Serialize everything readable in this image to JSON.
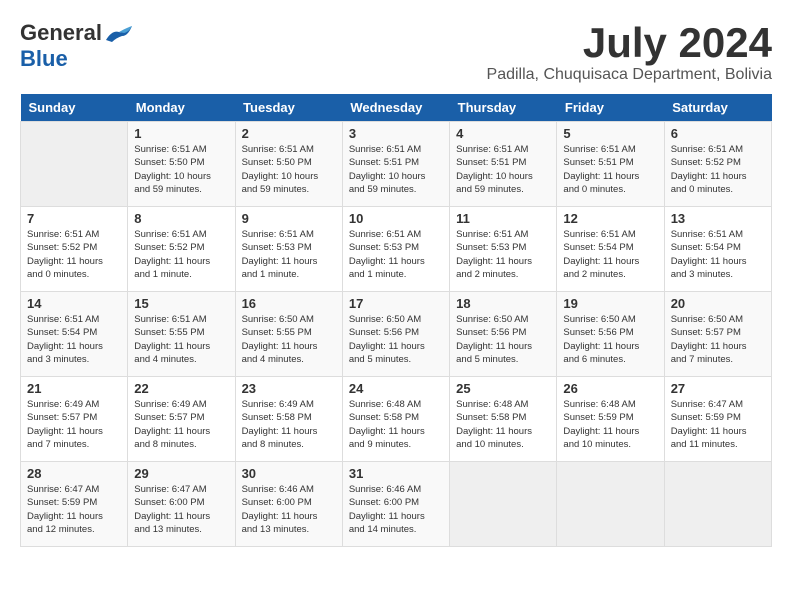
{
  "header": {
    "logo_general": "General",
    "logo_blue": "Blue",
    "month": "July 2024",
    "location": "Padilla, Chuquisaca Department, Bolivia"
  },
  "calendar": {
    "weekdays": [
      "Sunday",
      "Monday",
      "Tuesday",
      "Wednesday",
      "Thursday",
      "Friday",
      "Saturday"
    ],
    "weeks": [
      [
        {
          "day": "",
          "info": ""
        },
        {
          "day": "1",
          "info": "Sunrise: 6:51 AM\nSunset: 5:50 PM\nDaylight: 10 hours\nand 59 minutes."
        },
        {
          "day": "2",
          "info": "Sunrise: 6:51 AM\nSunset: 5:50 PM\nDaylight: 10 hours\nand 59 minutes."
        },
        {
          "day": "3",
          "info": "Sunrise: 6:51 AM\nSunset: 5:51 PM\nDaylight: 10 hours\nand 59 minutes."
        },
        {
          "day": "4",
          "info": "Sunrise: 6:51 AM\nSunset: 5:51 PM\nDaylight: 10 hours\nand 59 minutes."
        },
        {
          "day": "5",
          "info": "Sunrise: 6:51 AM\nSunset: 5:51 PM\nDaylight: 11 hours\nand 0 minutes."
        },
        {
          "day": "6",
          "info": "Sunrise: 6:51 AM\nSunset: 5:52 PM\nDaylight: 11 hours\nand 0 minutes."
        }
      ],
      [
        {
          "day": "7",
          "info": "Sunrise: 6:51 AM\nSunset: 5:52 PM\nDaylight: 11 hours\nand 0 minutes."
        },
        {
          "day": "8",
          "info": "Sunrise: 6:51 AM\nSunset: 5:52 PM\nDaylight: 11 hours\nand 1 minute."
        },
        {
          "day": "9",
          "info": "Sunrise: 6:51 AM\nSunset: 5:53 PM\nDaylight: 11 hours\nand 1 minute."
        },
        {
          "day": "10",
          "info": "Sunrise: 6:51 AM\nSunset: 5:53 PM\nDaylight: 11 hours\nand 1 minute."
        },
        {
          "day": "11",
          "info": "Sunrise: 6:51 AM\nSunset: 5:53 PM\nDaylight: 11 hours\nand 2 minutes."
        },
        {
          "day": "12",
          "info": "Sunrise: 6:51 AM\nSunset: 5:54 PM\nDaylight: 11 hours\nand 2 minutes."
        },
        {
          "day": "13",
          "info": "Sunrise: 6:51 AM\nSunset: 5:54 PM\nDaylight: 11 hours\nand 3 minutes."
        }
      ],
      [
        {
          "day": "14",
          "info": "Sunrise: 6:51 AM\nSunset: 5:54 PM\nDaylight: 11 hours\nand 3 minutes."
        },
        {
          "day": "15",
          "info": "Sunrise: 6:51 AM\nSunset: 5:55 PM\nDaylight: 11 hours\nand 4 minutes."
        },
        {
          "day": "16",
          "info": "Sunrise: 6:50 AM\nSunset: 5:55 PM\nDaylight: 11 hours\nand 4 minutes."
        },
        {
          "day": "17",
          "info": "Sunrise: 6:50 AM\nSunset: 5:56 PM\nDaylight: 11 hours\nand 5 minutes."
        },
        {
          "day": "18",
          "info": "Sunrise: 6:50 AM\nSunset: 5:56 PM\nDaylight: 11 hours\nand 5 minutes."
        },
        {
          "day": "19",
          "info": "Sunrise: 6:50 AM\nSunset: 5:56 PM\nDaylight: 11 hours\nand 6 minutes."
        },
        {
          "day": "20",
          "info": "Sunrise: 6:50 AM\nSunset: 5:57 PM\nDaylight: 11 hours\nand 7 minutes."
        }
      ],
      [
        {
          "day": "21",
          "info": "Sunrise: 6:49 AM\nSunset: 5:57 PM\nDaylight: 11 hours\nand 7 minutes."
        },
        {
          "day": "22",
          "info": "Sunrise: 6:49 AM\nSunset: 5:57 PM\nDaylight: 11 hours\nand 8 minutes."
        },
        {
          "day": "23",
          "info": "Sunrise: 6:49 AM\nSunset: 5:58 PM\nDaylight: 11 hours\nand 8 minutes."
        },
        {
          "day": "24",
          "info": "Sunrise: 6:48 AM\nSunset: 5:58 PM\nDaylight: 11 hours\nand 9 minutes."
        },
        {
          "day": "25",
          "info": "Sunrise: 6:48 AM\nSunset: 5:58 PM\nDaylight: 11 hours\nand 10 minutes."
        },
        {
          "day": "26",
          "info": "Sunrise: 6:48 AM\nSunset: 5:59 PM\nDaylight: 11 hours\nand 10 minutes."
        },
        {
          "day": "27",
          "info": "Sunrise: 6:47 AM\nSunset: 5:59 PM\nDaylight: 11 hours\nand 11 minutes."
        }
      ],
      [
        {
          "day": "28",
          "info": "Sunrise: 6:47 AM\nSunset: 5:59 PM\nDaylight: 11 hours\nand 12 minutes."
        },
        {
          "day": "29",
          "info": "Sunrise: 6:47 AM\nSunset: 6:00 PM\nDaylight: 11 hours\nand 13 minutes."
        },
        {
          "day": "30",
          "info": "Sunrise: 6:46 AM\nSunset: 6:00 PM\nDaylight: 11 hours\nand 13 minutes."
        },
        {
          "day": "31",
          "info": "Sunrise: 6:46 AM\nSunset: 6:00 PM\nDaylight: 11 hours\nand 14 minutes."
        },
        {
          "day": "",
          "info": ""
        },
        {
          "day": "",
          "info": ""
        },
        {
          "day": "",
          "info": ""
        }
      ]
    ]
  }
}
